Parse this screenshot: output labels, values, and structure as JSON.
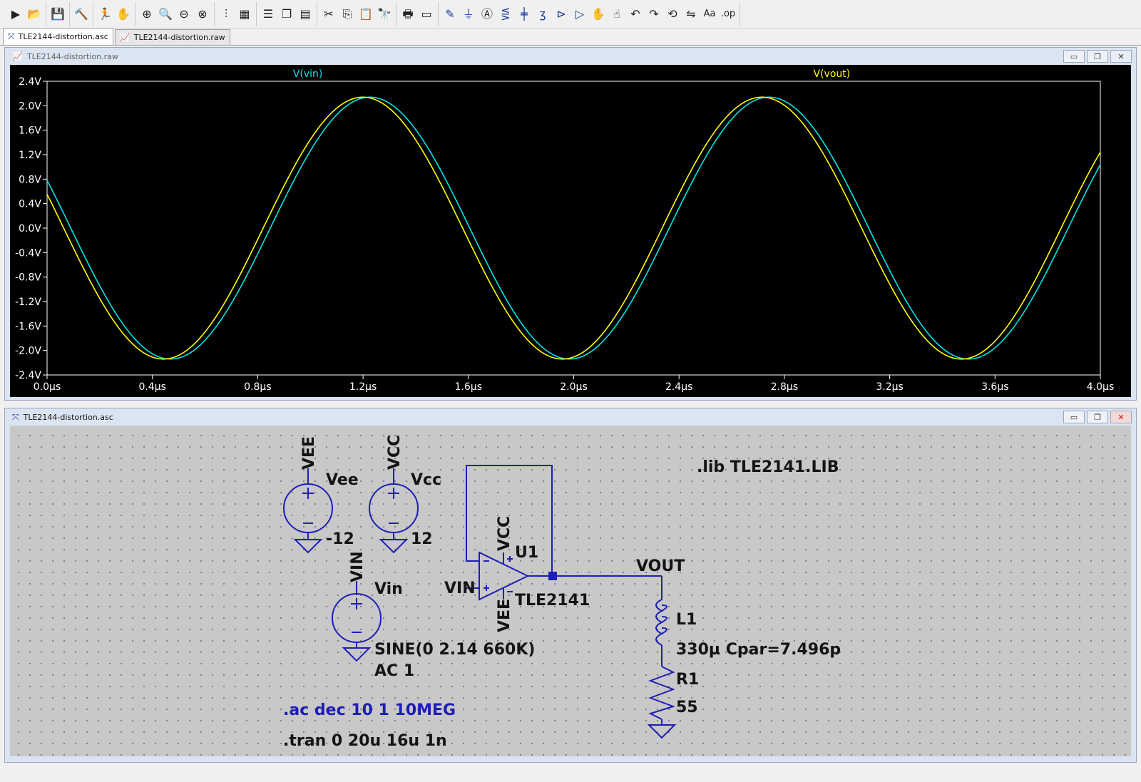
{
  "toolbar": {
    "groups": [
      [
        "run-icon",
        "open-icon"
      ],
      [
        "save-icon"
      ],
      [
        "control-panel-icon"
      ],
      [
        "run-sim-icon",
        "halt-icon"
      ],
      [
        "zoom-in-icon",
        "zoom-fit-icon",
        "zoom-out-icon",
        "zoom-cancel-icon"
      ],
      [
        "autorange-icon",
        "plot-settings-icon"
      ],
      [
        "tile-horizontal-icon",
        "cascade-icon",
        "tile-vertical-icon"
      ],
      [
        "cut-icon",
        "copy-icon",
        "paste-icon",
        "find-icon"
      ],
      [
        "print-icon",
        "print-preview-icon"
      ],
      [
        "draw-wire-icon",
        "ground-icon",
        "label-net-icon",
        "resistor-icon",
        "capacitor-icon",
        "inductor-icon",
        "diode-icon",
        "component-icon",
        "move-icon",
        "drag-icon",
        "undo-icon",
        "redo-icon",
        "rotate-icon",
        "mirror-icon",
        "text-icon",
        "spice-directive-icon"
      ]
    ],
    "glyphs": {
      "run-icon": "▶",
      "open-icon": "📂",
      "save-icon": "💾",
      "control-panel-icon": "🔨",
      "run-sim-icon": "🏃",
      "halt-icon": "✋",
      "zoom-in-icon": "⊕",
      "zoom-fit-icon": "🔍",
      "zoom-out-icon": "⊖",
      "zoom-cancel-icon": "⊗",
      "autorange-icon": "⫶",
      "plot-settings-icon": "▦",
      "tile-horizontal-icon": "☰",
      "cascade-icon": "❐",
      "tile-vertical-icon": "▤",
      "cut-icon": "✂",
      "copy-icon": "⎘",
      "paste-icon": "📋",
      "find-icon": "🔭",
      "print-icon": "🖶",
      "print-preview-icon": "▭",
      "draw-wire-icon": "✎",
      "ground-icon": "⏚",
      "label-net-icon": "Ⓐ",
      "resistor-icon": "⋚",
      "capacitor-icon": "╪",
      "inductor-icon": "ʒ",
      "diode-icon": "⊳",
      "component-icon": "▷",
      "move-icon": "✋",
      "drag-icon": "☝",
      "undo-icon": "↶",
      "redo-icon": "↷",
      "rotate-icon": "⟲",
      "mirror-icon": "⇋",
      "text-icon": "Aa",
      "spice-directive-icon": ".op"
    }
  },
  "tabs": [
    {
      "label": "TLE2144-distortion.asc",
      "icon": "schematic-icon",
      "active": true
    },
    {
      "label": "TLE2144-distortion.raw",
      "icon": "waveform-icon",
      "active": false
    }
  ],
  "plot_window": {
    "title": "TLE2144-distortion.raw"
  },
  "schem_window": {
    "title": "TLE2144-distortion.asc"
  },
  "chart_data": {
    "type": "line",
    "series": [
      {
        "name": "V(vin)",
        "color": "#00e5e5",
        "amplitude": 2.14,
        "freq_mhz": 0.66,
        "phase_deg": -21.4
      },
      {
        "name": "V(vout)",
        "color": "#ffff00",
        "amplitude": 2.14,
        "freq_mhz": 0.66,
        "phase_deg": -15.0
      }
    ],
    "xlim": [
      0,
      4.0
    ],
    "ylim": [
      -2.4,
      2.4
    ],
    "x_ticks": [
      "0.0µs",
      "0.4µs",
      "0.8µs",
      "1.2µs",
      "1.6µs",
      "2.0µs",
      "2.4µs",
      "2.8µs",
      "3.2µs",
      "3.6µs",
      "4.0µs"
    ],
    "y_ticks": [
      "2.4V",
      "2.0V",
      "1.6V",
      "1.2V",
      "0.8V",
      "0.4V",
      "0.0V",
      "-0.4V",
      "-0.8V",
      "-1.2V",
      "-1.6V",
      "-2.0V",
      "-2.4V"
    ],
    "x_unit": "µs",
    "grid": false
  },
  "schematic": {
    "wire_color": "#1e1eb4",
    "text_color": "#141414",
    "directive_color": "#1e1eb4",
    "labels": {
      "vee_net": "VEE",
      "vee_name": "Vee",
      "vee_value": "-12",
      "vcc_net": "VCC",
      "vcc_name": "Vcc",
      "vcc_value": "12",
      "vin_net": "VIN",
      "vin_name": "Vin",
      "vin_value1": "SINE(0 2.14 660K)",
      "vin_value2": "AC 1",
      "opamp_vcc": "VCC",
      "opamp_vee": "VEE",
      "opamp_vin": "VIN",
      "opamp_name": "U1",
      "opamp_model": "TLE2141",
      "vout_net": "VOUT",
      "l1_name": "L1",
      "l1_value": "330µ Cpar=7.496p",
      "r1_name": "R1",
      "r1_value": "55",
      "lib": ".lib TLE2141.LIB",
      "ac": ".ac dec 10 1 10MEG",
      "tran": ".tran 0 20u 16u 1n"
    }
  }
}
